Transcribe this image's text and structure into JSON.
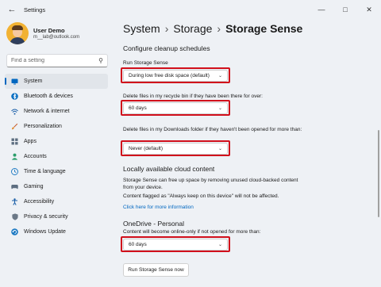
{
  "window": {
    "title": "Settings"
  },
  "user": {
    "name": "User Demo",
    "email": "m__lab@outlook.com"
  },
  "search": {
    "placeholder": "Find a setting"
  },
  "sidebar": {
    "items": [
      {
        "label": "System",
        "icon": "display-icon",
        "active": true
      },
      {
        "label": "Bluetooth & devices",
        "icon": "bluetooth-icon"
      },
      {
        "label": "Network & internet",
        "icon": "network-icon"
      },
      {
        "label": "Personalization",
        "icon": "brush-icon"
      },
      {
        "label": "Apps",
        "icon": "apps-icon"
      },
      {
        "label": "Accounts",
        "icon": "person-icon"
      },
      {
        "label": "Time & language",
        "icon": "globe-clock-icon"
      },
      {
        "label": "Gaming",
        "icon": "controller-icon"
      },
      {
        "label": "Accessibility",
        "icon": "accessibility-icon"
      },
      {
        "label": "Privacy & security",
        "icon": "shield-icon"
      },
      {
        "label": "Windows Update",
        "icon": "update-icon"
      }
    ]
  },
  "breadcrumb": {
    "part1": "System",
    "part2": "Storage",
    "current": "Storage Sense"
  },
  "cleanup": {
    "heading": "Configure cleanup schedules",
    "run_label": "Run Storage Sense",
    "run_value": "During low free disk space (default)",
    "recycle_label": "Delete files in my recycle bin if they have been there for over:",
    "recycle_value": "60 days",
    "downloads_label": "Delete files in my Downloads folder if they haven't been opened for more than:",
    "downloads_value": "Never (default)"
  },
  "cloud": {
    "heading": "Locally available cloud content",
    "desc": "Storage Sense can free up space by removing unused cloud-backed content from your device.",
    "note": "Content flagged as \"Always keep on this device\" will not be affected.",
    "link": "Click here for more information"
  },
  "onedrive": {
    "heading": "OneDrive - Personal",
    "label": "Content will become online-only if not opened for more than:",
    "value": "60 days"
  },
  "run_now_button": "Run Storage Sense now",
  "colors": {
    "accent": "#0067c0",
    "highlight": "#d10f1b"
  }
}
